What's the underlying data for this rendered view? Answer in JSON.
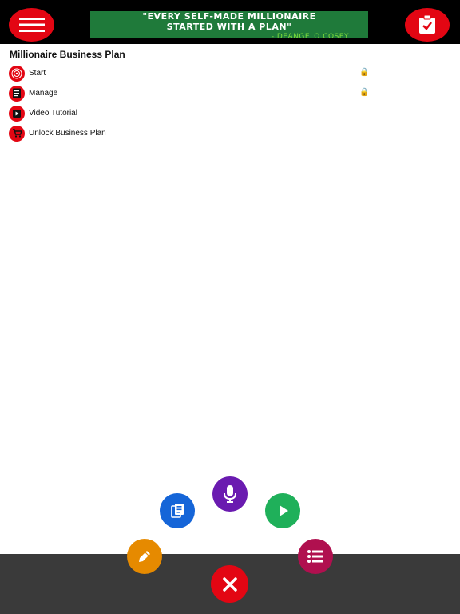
{
  "header": {
    "menu_icon": "hamburger-menu-icon",
    "clipboard_icon": "clipboard-check-icon",
    "banner": {
      "line1": "\"EVERY SELF-MADE MILLIONAIRE",
      "line2": "STARTED WITH A PLAN\"",
      "line3": "- DEANGELO COSEY"
    }
  },
  "plan": {
    "title": "Millionaire Business Plan",
    "items": [
      {
        "label": "Start",
        "icon": "target-icon",
        "locked": true
      },
      {
        "label": "Manage",
        "icon": "document-icon",
        "locked": true
      },
      {
        "label": "Video Tutorial",
        "icon": "play-video-icon",
        "locked": false
      },
      {
        "label": "Unlock Business Plan",
        "icon": "cart-icon",
        "locked": false
      }
    ]
  },
  "fab_menu": {
    "notes_color": "#e68a00",
    "document_color": "#1565d8",
    "mic_color": "#6a1bb0",
    "play_color": "#1fb05a",
    "list_color": "#b0104f",
    "close_color": "#e30613"
  },
  "colors": {
    "accent_red": "#e30613",
    "banner_green": "#1f7a3a",
    "bottom_bar": "#3a3a3a"
  }
}
